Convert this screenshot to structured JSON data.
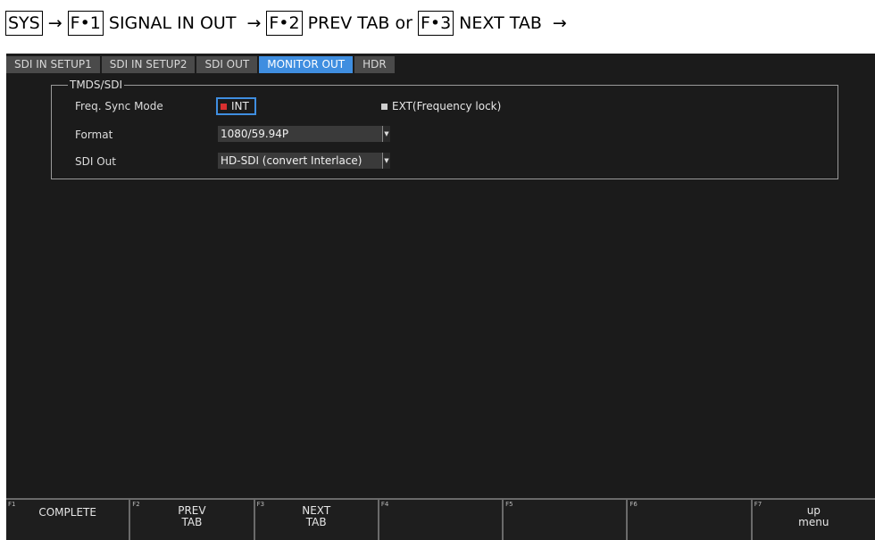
{
  "breadcrumb": {
    "k1": "SYS",
    "a1": "→",
    "k2": "F•1",
    "t2": "SIGNAL IN OUT",
    "a2": "→",
    "k3": "F•2",
    "t3": "PREV TAB or",
    "k4": "F•3",
    "t4": "NEXT TAB",
    "a4": "→"
  },
  "tabs": [
    "SDI IN SETUP1",
    "SDI IN SETUP2",
    "SDI OUT",
    "MONITOR OUT",
    "HDR"
  ],
  "active_tab": "MONITOR OUT",
  "group": {
    "title": "TMDS/SDI",
    "freq_label": "Freq. Sync Mode",
    "int_label": "INT",
    "ext_label": "EXT(Frequency lock)",
    "format_label": "Format",
    "format_value": "1080/59.94P",
    "sdiout_label": "SDI Out",
    "sdiout_value": "HD-SDI (convert Interlace)"
  },
  "fkeys": [
    {
      "num": "F1",
      "label": "COMPLETE"
    },
    {
      "num": "F2",
      "label": "PREV\nTAB"
    },
    {
      "num": "F3",
      "label": "NEXT\nTAB"
    },
    {
      "num": "F4",
      "label": ""
    },
    {
      "num": "F5",
      "label": ""
    },
    {
      "num": "F6",
      "label": ""
    },
    {
      "num": "F7",
      "label": "up\nmenu"
    }
  ],
  "colors": {
    "accent": "#3f8ee0",
    "background": "#1b1b1b",
    "check_on": "#d93030"
  }
}
